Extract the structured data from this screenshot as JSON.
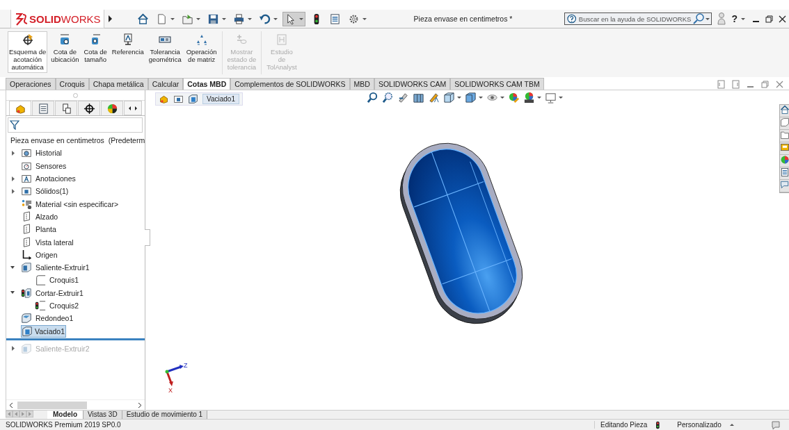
{
  "title_bar": {
    "logo": "**SOLID**WORKS",
    "quick_access": [
      {
        "kind": "home",
        "dropdown": false,
        "pressed": false
      },
      {
        "kind": "new",
        "dropdown": true,
        "pressed": false
      },
      {
        "kind": "open",
        "dropdown": true,
        "pressed": false
      },
      {
        "kind": "save",
        "dropdown": true,
        "pressed": false
      },
      {
        "kind": "print",
        "dropdown": true,
        "pressed": false
      },
      {
        "kind": "undo",
        "dropdown": true,
        "pressed": false
      },
      {
        "kind": "select",
        "dropdown": true,
        "pressed": true
      },
      {
        "kind": "traffic",
        "dropdown": false,
        "pressed": false
      },
      {
        "kind": "list",
        "dropdown": false,
        "pressed": false
      },
      {
        "kind": "gear",
        "dropdown": true,
        "pressed": false
      }
    ],
    "title": "Pieza envase en centimetros *",
    "search": {
      "placeholder": "Buscar en la ayuda de SOLIDWORKS"
    },
    "help": "?"
  },
  "ribbon": [
    {
      "label": "Esquema de\nacotación\nautomática",
      "kind": "auto",
      "selected": true,
      "disabled": false
    },
    {
      "label": "Cota de\nubicación",
      "kind": "loc",
      "selected": false,
      "disabled": false
    },
    {
      "label": "Cota de\ntamaño",
      "kind": "size",
      "selected": false,
      "disabled": false
    },
    {
      "label": "Referencia",
      "kind": "ref",
      "selected": false,
      "disabled": false
    },
    {
      "label": "Tolerancia\ngeométrica",
      "kind": "tol",
      "selected": false,
      "disabled": false
    },
    {
      "label": "Operación\nde matriz",
      "kind": "pattern",
      "selected": false,
      "disabled": false
    },
    {
      "label": "Mostrar\nestado de\ntolerancia",
      "kind": "show",
      "selected": false,
      "disabled": true
    },
    {
      "label": "Estudio\nde\nTolAnalyst",
      "kind": "study",
      "selected": false,
      "disabled": true
    }
  ],
  "command_tabs": [
    {
      "label": "Operaciones",
      "selected": false
    },
    {
      "label": "Croquis",
      "selected": false
    },
    {
      "label": "Chapa metálica",
      "selected": false
    },
    {
      "label": "Calcular",
      "selected": false
    },
    {
      "label": "Cotas MBD",
      "selected": true
    },
    {
      "label": "Complementos de SOLIDWORKS",
      "selected": false
    },
    {
      "label": "MBD",
      "selected": false
    },
    {
      "label": "SOLIDWORKS CAM",
      "selected": false
    },
    {
      "label": "SOLIDWORKS CAM TBM",
      "selected": false
    }
  ],
  "manager_tabs": [
    {
      "kind": "feature",
      "selected": true
    },
    {
      "kind": "property",
      "selected": false
    },
    {
      "kind": "config",
      "selected": false
    },
    {
      "kind": "dimxpert",
      "selected": false
    },
    {
      "kind": "display",
      "selected": false
    }
  ],
  "tree": {
    "label": "Pieza envase en centimetros  (Predeterm",
    "children": [
      {
        "kind": "history",
        "label": "Historial",
        "expanded": false,
        "selected": false,
        "disabled": false
      },
      {
        "kind": "sensor",
        "label": "Sensores",
        "selected": false,
        "disabled": false
      },
      {
        "kind": "annot",
        "label": "Anotaciones",
        "expanded": false,
        "selected": false,
        "disabled": false
      },
      {
        "kind": "solids",
        "label": "Sólidos(1)",
        "expanded": false,
        "selected": false,
        "disabled": false
      },
      {
        "kind": "material",
        "label": "Material <sin especificar>",
        "selected": false,
        "disabled": false
      },
      {
        "kind": "plane",
        "label": "Alzado",
        "selected": false,
        "disabled": false
      },
      {
        "kind": "plane",
        "label": "Planta",
        "selected": false,
        "disabled": false
      },
      {
        "kind": "plane",
        "label": "Vista lateral",
        "selected": false,
        "disabled": false
      },
      {
        "kind": "origin",
        "label": "Origen",
        "selected": false,
        "disabled": false
      },
      {
        "kind": "extrude",
        "label": "Saliente-Extruir1",
        "expanded": true,
        "selected": false,
        "disabled": false,
        "children": [
          {
            "kind": "sketch",
            "label": "Croquis1",
            "selected": false,
            "disabled": false
          }
        ]
      },
      {
        "kind": "cut",
        "label": "Cortar-Extruir1",
        "expanded": true,
        "selected": false,
        "disabled": false,
        "children": [
          {
            "kind": "sketch-error",
            "label": "Croquis2",
            "selected": false,
            "disabled": false
          }
        ]
      },
      {
        "kind": "fillet",
        "label": "Redondeo1",
        "selected": false,
        "disabled": false
      },
      {
        "kind": "shell",
        "label": "Vaciado1",
        "selected": true,
        "disabled": false
      },
      {
        "kind": "rollback-bar"
      },
      {
        "kind": "extrude",
        "label": "Saliente-Extruir2",
        "expanded": false,
        "selected": false,
        "disabled": true
      }
    ]
  },
  "breadcrumb": {
    "label": "Vaciado1"
  },
  "heads_up": [
    {
      "kind": "zoom-fit",
      "dropdown": false
    },
    {
      "kind": "zoom-area",
      "dropdown": false
    },
    {
      "kind": "prev-view",
      "dropdown": false
    },
    {
      "kind": "section",
      "dropdown": false
    },
    {
      "kind": "dynamic",
      "dropdown": false
    },
    {
      "kind": "orient",
      "dropdown": true
    },
    {
      "kind": "display-style",
      "dropdown": true
    },
    {
      "kind": "hide-show",
      "dropdown": true
    },
    {
      "kind": "appearance",
      "dropdown": false
    },
    {
      "kind": "scene",
      "dropdown": true
    },
    {
      "kind": "monitor",
      "dropdown": true
    }
  ],
  "triad": {
    "x": "X",
    "z": "Z"
  },
  "bottom_tabs": [
    {
      "label": "Modelo",
      "selected": true
    },
    {
      "label": "Vistas 3D",
      "selected": false
    },
    {
      "label": "Estudio de movimiento 1",
      "selected": false
    }
  ],
  "status_bar": {
    "product": "SOLIDWORKS Premium 2019 SP0.0",
    "mode": "Editando Pieza",
    "units": "Personalizado"
  }
}
